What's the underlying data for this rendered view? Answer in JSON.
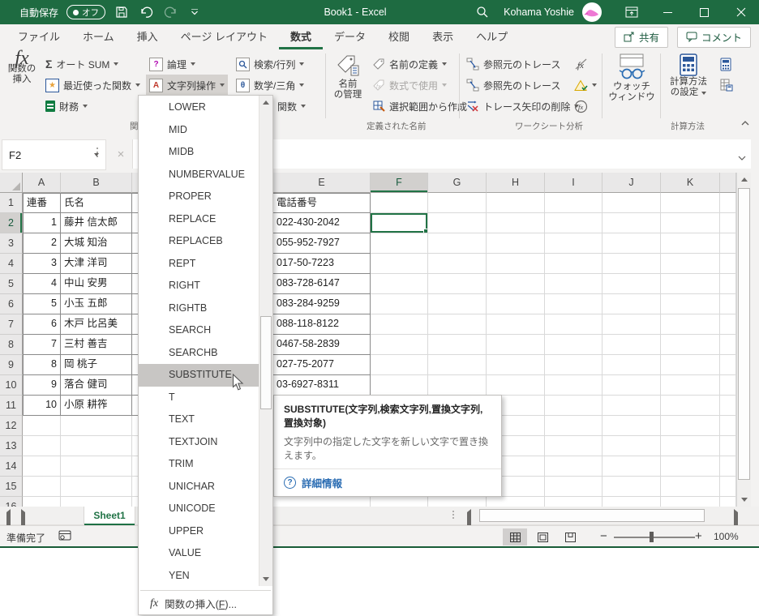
{
  "colors": {
    "accent": "#217346",
    "titlebar": "#1e6b41",
    "menu_highlight": "#c8c6c4",
    "link_blue": "#2b6db3",
    "financial_green": "#107c41"
  },
  "title_bar": {
    "autosave_label": "自動保存",
    "autosave_state": "オフ",
    "workbook_title": "Book1  -  Excel",
    "user_name": "Kohama Yoshie"
  },
  "ribbon_tabs": {
    "active_index": 4,
    "items": [
      "ファイル",
      "ホーム",
      "挿入",
      "ページ レイアウト",
      "数式",
      "データ",
      "校閲",
      "表示",
      "ヘルプ"
    ]
  },
  "tab_actions": {
    "share": "共有",
    "comments": "コメント"
  },
  "ribbon": {
    "insert_function_l1": "関数の",
    "insert_function_l2": "挿入",
    "autosum": "オート SUM",
    "recent": "最近使った関数",
    "financial": "財務",
    "logical": "論理",
    "text_ops": "文字列操作",
    "lookup": "検索/行列",
    "math_trig": "数学/三角",
    "more_functions_partial": "関数",
    "function_library_group_partial": "関",
    "name_manager_l1": "名前",
    "name_manager_l2": "の管理",
    "define_name": "名前の定義",
    "use_in_formula": "数式で使用",
    "create_from_selection": "選択範囲から作成",
    "defined_names_group": "定義された名前",
    "trace_precedents": "参照元のトレース",
    "trace_dependents": "参照先のトレース",
    "remove_arrows": "トレース矢印の削除",
    "auditing_group": "ワークシート分析",
    "watch_l1": "ウォッチ",
    "watch_l2": "ウィンドウ",
    "calc_options_l1": "計算方法",
    "calc_options_l2": "の設定",
    "calculation_group": "計算方法"
  },
  "formula_bar": {
    "name_box": "F2"
  },
  "sheet": {
    "columns": [
      "A",
      "B",
      "",
      "",
      "E",
      "F",
      "G",
      "H",
      "I",
      "J",
      "K",
      ""
    ],
    "row_count": 16,
    "selected_cell": "F2",
    "table": {
      "no_header": "連番",
      "name_header": "氏名",
      "phone_header": "電話番号",
      "rows": [
        {
          "no": "1",
          "name": "藤井 信太郎",
          "phone": "022-430-2042"
        },
        {
          "no": "2",
          "name": "大城 知治",
          "phone": "055-952-7927"
        },
        {
          "no": "3",
          "name": "大津 洋司",
          "phone": "017-50-7223"
        },
        {
          "no": "4",
          "name": "中山 安男",
          "phone": "083-728-6147"
        },
        {
          "no": "5",
          "name": "小玉 五郎",
          "phone": "083-284-9259"
        },
        {
          "no": "6",
          "name": "木戸 比呂美",
          "phone": "088-118-8122"
        },
        {
          "no": "7",
          "name": "三村 善吉",
          "phone": "0467-58-2839"
        },
        {
          "no": "8",
          "name": "岡 桃子",
          "phone": "027-75-2077"
        },
        {
          "no": "9",
          "name": "落合 健司",
          "phone": "03-6927-8311"
        },
        {
          "no": "10",
          "name": "小原 耕筰",
          "phone": ""
        }
      ]
    }
  },
  "function_menu": {
    "items": [
      "LOWER",
      "MID",
      "MIDB",
      "NUMBERVALUE",
      "PROPER",
      "REPLACE",
      "REPLACEB",
      "REPT",
      "RIGHT",
      "RIGHTB",
      "SEARCH",
      "SEARCHB",
      "SUBSTITUTE",
      "T",
      "TEXT",
      "TEXTJOIN",
      "TRIM",
      "UNICHAR",
      "UNICODE",
      "UPPER",
      "VALUE",
      "YEN"
    ],
    "highlighted": "SUBSTITUTE",
    "footer_pre": "関数の挿入(",
    "footer_key": "F",
    "footer_post": ")..."
  },
  "tooltip": {
    "title": "SUBSTITUTE(文字列,検索文字列,置換文字列,置換対象)",
    "body": "文字列中の指定した文字を新しい文字で置き換えます。",
    "link": "詳細情報"
  },
  "sheet_tabs": {
    "active": "Sheet1"
  },
  "status_bar": {
    "ready": "準備完了",
    "zoom": "100%"
  }
}
